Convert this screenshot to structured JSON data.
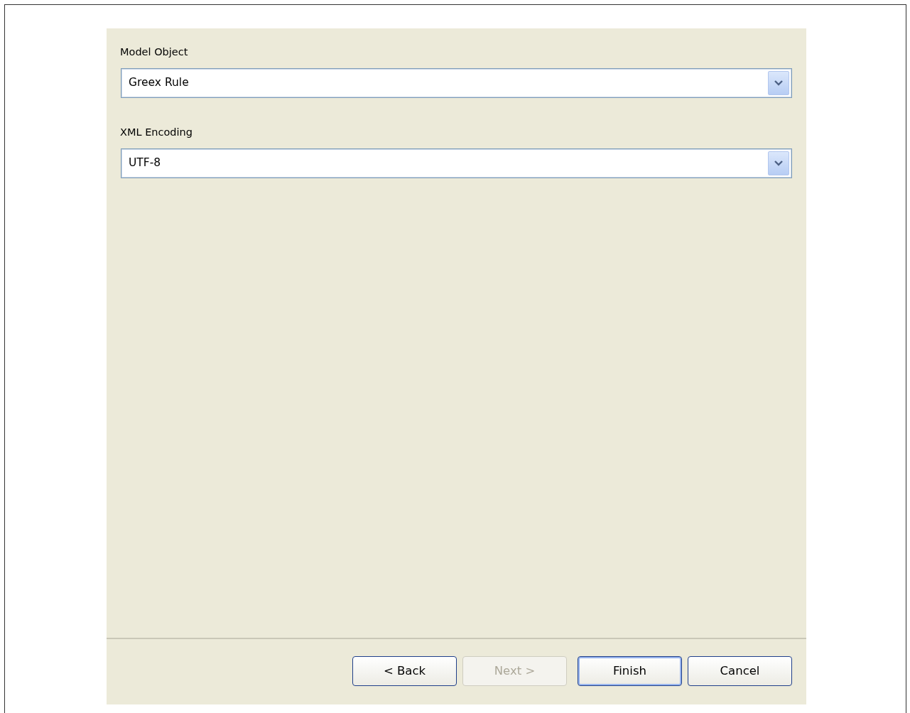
{
  "fields": [
    {
      "label": "Model Object",
      "value": "Greex Rule"
    },
    {
      "label": "XML Encoding",
      "value": "UTF-8"
    }
  ],
  "buttons": [
    {
      "label": "< Back",
      "disabled": false,
      "default": false
    },
    {
      "label": "Next >",
      "disabled": true,
      "default": false
    },
    {
      "label": "Finish",
      "disabled": false,
      "default": true
    },
    {
      "label": "Cancel",
      "disabled": false,
      "default": false
    }
  ]
}
